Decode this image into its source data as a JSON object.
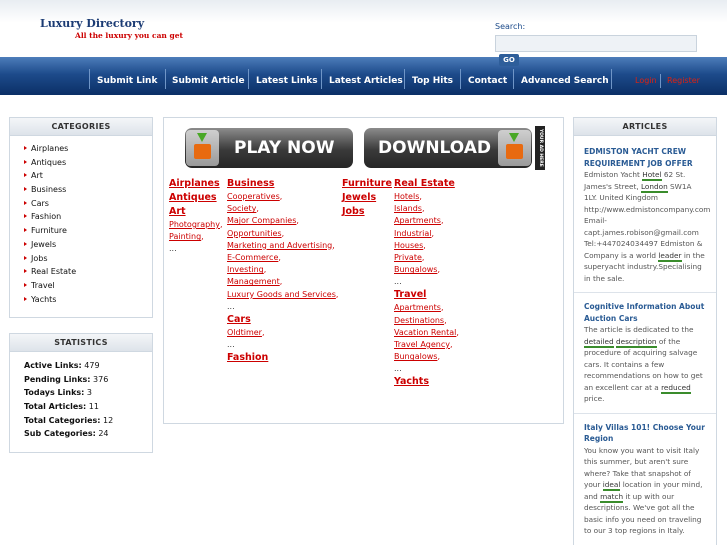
{
  "header": {
    "logo_title": "Luxury Directory",
    "logo_subtitle": "All the luxury you can get",
    "search_label": "Search:",
    "search_placeholder": "",
    "search_button": "GO"
  },
  "nav": {
    "items": [
      "Submit Link",
      "Submit Article",
      "Latest Links",
      "Latest Articles",
      "Top Hits",
      "Contact",
      "Advanced Search"
    ],
    "login": "Login",
    "register": "Register"
  },
  "categories": {
    "title": "CATEGORIES",
    "items": [
      "Airplanes",
      "Antiques",
      "Art",
      "Business",
      "Cars",
      "Fashion",
      "Furniture",
      "Jewels",
      "Jobs",
      "Real Estate",
      "Travel",
      "Yachts"
    ]
  },
  "statistics": {
    "title": "STATISTICS",
    "rows": [
      {
        "label": "Active Links:",
        "value": "479"
      },
      {
        "label": "Pending Links:",
        "value": "376"
      },
      {
        "label": "Todays Links:",
        "value": "3"
      },
      {
        "label": "Total Articles:",
        "value": "11"
      },
      {
        "label": "Total Categories:",
        "value": "12"
      },
      {
        "label": "Sub Categories:",
        "value": "24"
      }
    ]
  },
  "banner": {
    "play_label": "PLAY NOW",
    "download_label": "DOWNLOAD",
    "ad_label": "YOUR AD HERE"
  },
  "directory": {
    "col1": {
      "airplanes": "Airplanes",
      "antiques": "Antiques",
      "art": "Art",
      "art_subs": [
        "Photography",
        "Painting"
      ],
      "dots": "..."
    },
    "col2": {
      "business": "Business",
      "business_subs": [
        "Cooperatives",
        "Society",
        "Major Companies",
        "Opportunities",
        "Marketing and Advertising",
        "E-Commerce",
        "Investing",
        "Management",
        "Luxury Goods and Services"
      ],
      "cars": "Cars",
      "cars_subs": [
        "Oldtimer"
      ],
      "dots": "...",
      "fashion": "Fashion"
    },
    "col3": {
      "furniture": "Furniture",
      "jewels": "Jewels",
      "jobs": "Jobs"
    },
    "col4": {
      "real_estate": "Real Estate",
      "real_estate_subs": [
        "Hotels",
        "Islands",
        "Apartments",
        "Industrial",
        "Houses",
        "Private",
        "Bungalows"
      ],
      "travel": "Travel",
      "travel_subs": [
        "Apartments",
        "Destinations",
        "Vacation Rental",
        "Travel Agency",
        "Bungalows"
      ],
      "dots": "...",
      "yachts": "Yachts"
    }
  },
  "articles": {
    "title": "ARTICLES",
    "items": [
      {
        "title": "EDMISTON YACHT CREW REQUIREMENT JOB OFFER",
        "body_parts": [
          "Edmiston Yacht ",
          "Hotel",
          " 62 St. James's Street, ",
          "London",
          " SW1A 1LY. United Kingdom http://www.edmistoncompany.com Email- capt.james.robison@gmail.com Tel:+447024034497 Edmiston & Company is a world ",
          "leader",
          " in the superyacht industry.Specialising in the sale."
        ]
      },
      {
        "title": "Cognitive Information About Auction Cars",
        "body_parts": [
          "The article is dedicated to the ",
          "detailed",
          " ",
          "description",
          " of the procedure of acquiring salvage cars. It contains a few recommendations on how to get an excellent car at a ",
          "reduced",
          " price."
        ]
      },
      {
        "title": "Italy Villas 101! Choose Your Region",
        "body_parts": [
          "You know you want to visit Italy this summer, but aren't sure where? Take that snapshot of your ",
          "ideal",
          " location in your mind, and ",
          "match",
          " it up with our descriptions. We've got all the basic info you need on traveling to our 3 top regions in Italy."
        ]
      }
    ]
  }
}
